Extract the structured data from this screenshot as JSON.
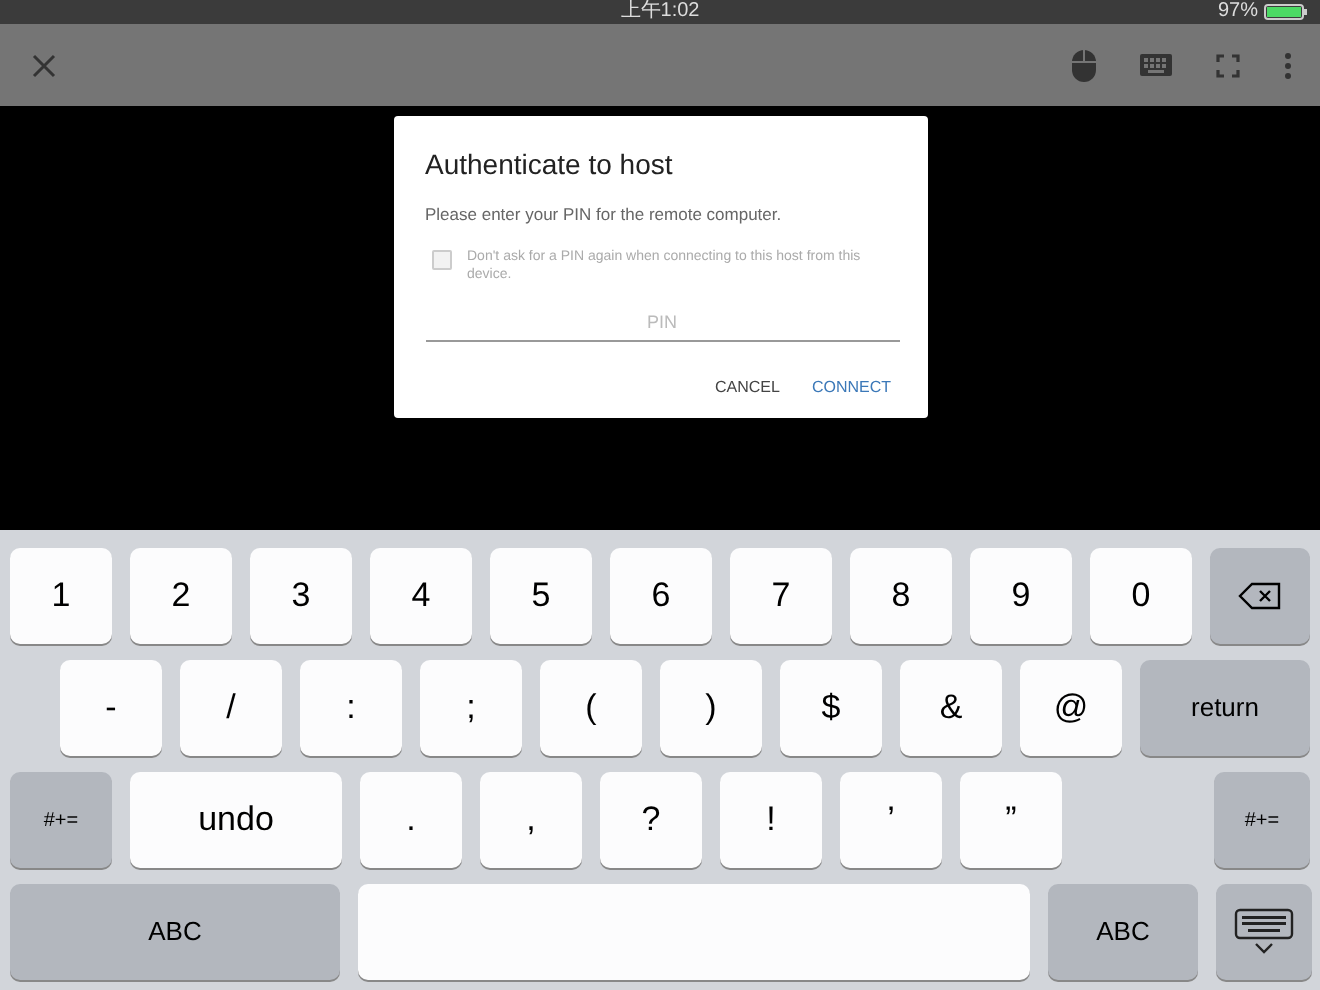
{
  "status_bar": {
    "time": "上午1:02",
    "battery": "97%"
  },
  "dialog": {
    "title": "Authenticate to host",
    "message": "Please enter your PIN for the remote computer.",
    "checkbox": {
      "label": "Don't ask for a PIN again when connecting to this host from this device.",
      "checked": false,
      "disabled": true
    },
    "pin_field": {
      "placeholder": "PIN"
    },
    "buttons": [
      {
        "label": "CANCEL",
        "kind": "secondary"
      },
      {
        "label": "CONNECT",
        "kind": "primary"
      }
    ]
  },
  "keyboard": {
    "rows": [
      [
        {
          "label": "1",
          "kind": "char"
        },
        {
          "label": "2",
          "kind": "char"
        },
        {
          "label": "3",
          "kind": "char"
        },
        {
          "label": "4",
          "kind": "char"
        },
        {
          "label": "5",
          "kind": "char"
        },
        {
          "label": "6",
          "kind": "char"
        },
        {
          "label": "7",
          "kind": "char"
        },
        {
          "label": "8",
          "kind": "char"
        },
        {
          "label": "9",
          "kind": "char"
        },
        {
          "label": "0",
          "kind": "char"
        },
        {
          "kind": "delete"
        }
      ],
      [
        {
          "label": "-",
          "kind": "char"
        },
        {
          "label": "/",
          "kind": "char"
        },
        {
          "label": ":",
          "kind": "char"
        },
        {
          "label": ";",
          "kind": "char"
        },
        {
          "label": "(",
          "kind": "char"
        },
        {
          "label": ")",
          "kind": "char"
        },
        {
          "label": "$",
          "kind": "char"
        },
        {
          "label": "&",
          "kind": "char"
        },
        {
          "label": "@",
          "kind": "char"
        },
        {
          "label": "return",
          "kind": "function"
        }
      ],
      [
        {
          "label": "#+=",
          "kind": "function"
        },
        {
          "label": "undo",
          "kind": "wide"
        },
        {
          "label": ".",
          "kind": "char"
        },
        {
          "label": ",",
          "kind": "char"
        },
        {
          "label": "?",
          "kind": "char"
        },
        {
          "label": "!",
          "kind": "char"
        },
        {
          "label": "’",
          "kind": "char"
        },
        {
          "label": "”",
          "kind": "char"
        },
        {
          "label": "#+=",
          "kind": "function"
        }
      ],
      [
        {
          "label": "ABC",
          "kind": "function"
        },
        {
          "kind": "space"
        },
        {
          "label": "ABC",
          "kind": "function"
        },
        {
          "kind": "dismiss"
        }
      ]
    ]
  }
}
